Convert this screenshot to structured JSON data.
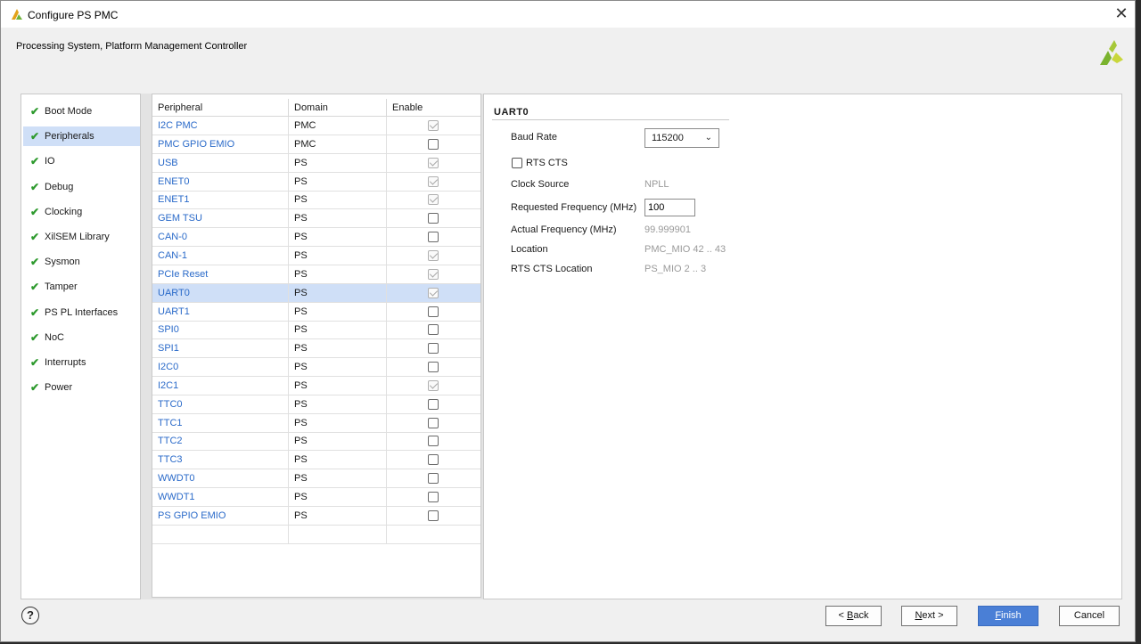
{
  "window": {
    "title": "Configure PS PMC",
    "close_glyph": "✕"
  },
  "header": {
    "subtitle": "Processing System, Platform Management Controller"
  },
  "nav": {
    "items": [
      {
        "label": "Boot Mode",
        "active": false
      },
      {
        "label": "Peripherals",
        "active": true
      },
      {
        "label": "IO",
        "active": false
      },
      {
        "label": "Debug",
        "active": false
      },
      {
        "label": "Clocking",
        "active": false
      },
      {
        "label": "XilSEM Library",
        "active": false
      },
      {
        "label": "Sysmon",
        "active": false
      },
      {
        "label": "Tamper",
        "active": false
      },
      {
        "label": "PS PL Interfaces",
        "active": false
      },
      {
        "label": "NoC",
        "active": false
      },
      {
        "label": "Interrupts",
        "active": false
      },
      {
        "label": "Power",
        "active": false
      }
    ]
  },
  "table": {
    "headers": {
      "peripheral": "Peripheral",
      "domain": "Domain",
      "enable": "Enable"
    },
    "rows": [
      {
        "peripheral": "I2C PMC",
        "domain": "PMC",
        "enabled": true
      },
      {
        "peripheral": "PMC GPIO EMIO",
        "domain": "PMC",
        "enabled": false
      },
      {
        "peripheral": "USB",
        "domain": "PS",
        "enabled": true
      },
      {
        "peripheral": "ENET0",
        "domain": "PS",
        "enabled": true
      },
      {
        "peripheral": "ENET1",
        "domain": "PS",
        "enabled": true
      },
      {
        "peripheral": "GEM TSU",
        "domain": "PS",
        "enabled": false
      },
      {
        "peripheral": "CAN-0",
        "domain": "PS",
        "enabled": false
      },
      {
        "peripheral": "CAN-1",
        "domain": "PS",
        "enabled": true
      },
      {
        "peripheral": "PCIe Reset",
        "domain": "PS",
        "enabled": true
      },
      {
        "peripheral": "UART0",
        "domain": "PS",
        "enabled": true,
        "selected": true
      },
      {
        "peripheral": "UART1",
        "domain": "PS",
        "enabled": false
      },
      {
        "peripheral": "SPI0",
        "domain": "PS",
        "enabled": false
      },
      {
        "peripheral": "SPI1",
        "domain": "PS",
        "enabled": false
      },
      {
        "peripheral": "I2C0",
        "domain": "PS",
        "enabled": false
      },
      {
        "peripheral": "I2C1",
        "domain": "PS",
        "enabled": true
      },
      {
        "peripheral": "TTC0",
        "domain": "PS",
        "enabled": false
      },
      {
        "peripheral": "TTC1",
        "domain": "PS",
        "enabled": false
      },
      {
        "peripheral": "TTC2",
        "domain": "PS",
        "enabled": false
      },
      {
        "peripheral": "TTC3",
        "domain": "PS",
        "enabled": false
      },
      {
        "peripheral": "WWDT0",
        "domain": "PS",
        "enabled": false
      },
      {
        "peripheral": "WWDT1",
        "domain": "PS",
        "enabled": false
      },
      {
        "peripheral": "PS GPIO EMIO",
        "domain": "PS",
        "enabled": false
      }
    ]
  },
  "props": {
    "title": "UART0",
    "baud_rate_label": "Baud Rate",
    "baud_rate_value": "115200",
    "rts_cts_label": "RTS CTS",
    "rts_cts_checked": false,
    "clock_source_label": "Clock Source",
    "clock_source_value": "NPLL",
    "req_freq_label": "Requested Frequency (MHz)",
    "req_freq_value": "100",
    "actual_freq_label": "Actual Frequency (MHz)",
    "actual_freq_value": "99.999901",
    "location_label": "Location",
    "location_value": "PMC_MIO 42 .. 43",
    "rts_cts_location_label": "RTS CTS Location",
    "rts_cts_location_value": "PS_MIO 2 .. 3"
  },
  "footer": {
    "help": "?",
    "back_prefix": "< ",
    "back_key": "B",
    "back_rest": "ack",
    "next_key": "N",
    "next_rest": "ext >",
    "finish_key": "F",
    "finish_rest": "inish",
    "cancel": "Cancel"
  },
  "colors": {
    "accent": "#4a7fd6",
    "selection": "#cfdff7",
    "link": "#2a6ac9",
    "check": "#2e9a2e"
  }
}
